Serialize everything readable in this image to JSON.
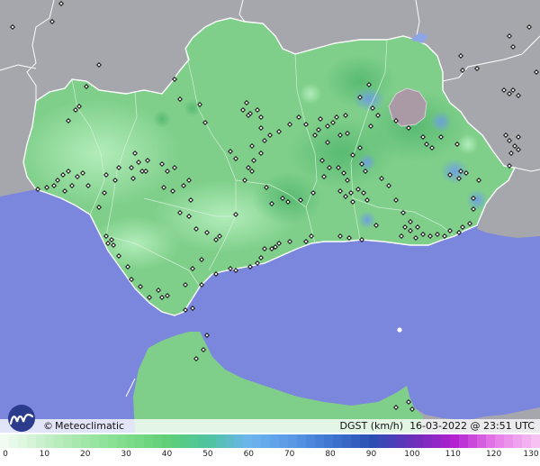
{
  "map": {
    "brand": "Meteoclimatic",
    "copyright_symbol": "©",
    "variable": "DGST (km/h)",
    "timestamp": "16-03-2022 @ 23:51 UTC",
    "colors": {
      "sea": "#7b86dd",
      "land_outside": "#a6a6ad",
      "region_fill": "#7fcf8a",
      "border": "#ffffff",
      "station_marker": "#111111",
      "logo_blue": "#2c3c8c"
    }
  },
  "legend": {
    "ticks": [
      "0",
      "10",
      "20",
      "30",
      "40",
      "50",
      "60",
      "70",
      "80",
      "90",
      "100",
      "110",
      "120",
      "130"
    ],
    "colors": [
      "#f2fbf2",
      "#c6efc8",
      "#9fe6a6",
      "#7fdc8a",
      "#5fcf76",
      "#4fc39f",
      "#6cb4ee",
      "#5b9ae6",
      "#3f74cf",
      "#2a4fb4",
      "#6a2fb8",
      "#b21fd0",
      "#e67be8",
      "#f6c2f2"
    ]
  }
}
